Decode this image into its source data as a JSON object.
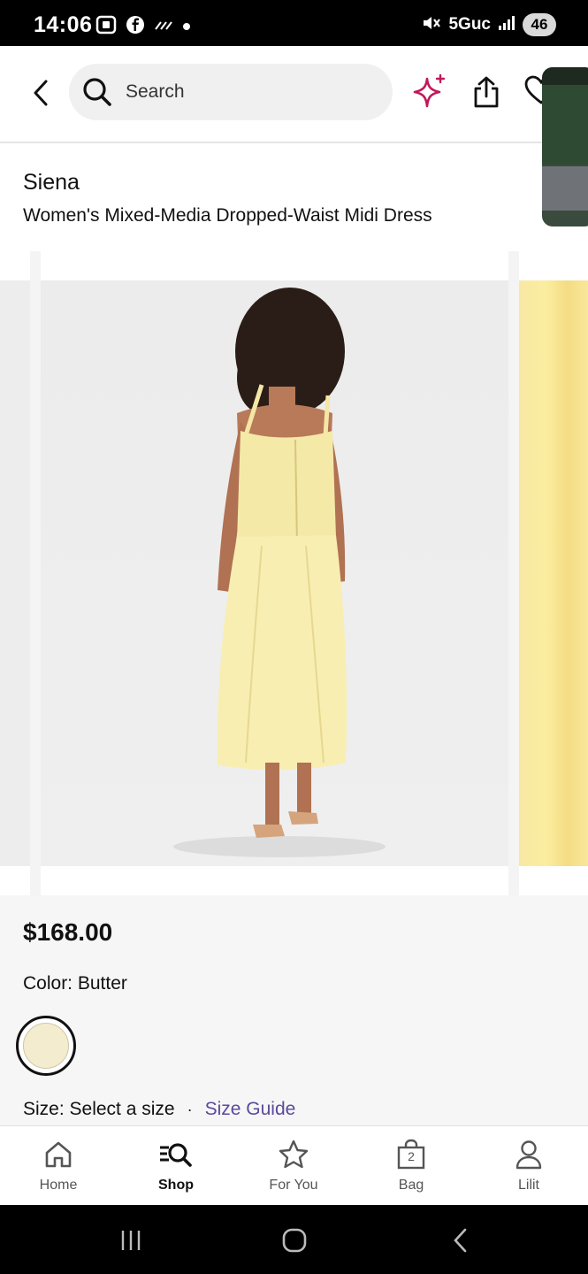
{
  "status_bar": {
    "time": "14:06",
    "network": "5Guc",
    "battery": "46",
    "left_icons": [
      "screenshot-icon",
      "facebook-icon",
      "wifi-calling-icon",
      "dot-icon"
    ],
    "right_icons": [
      "mute-icon",
      "signal-icon"
    ]
  },
  "header": {
    "search_placeholder": "Search",
    "accent_color": "#c2185b"
  },
  "product": {
    "brand": "Siena",
    "name": "Women's Mixed-Media Dropped-Waist Midi Dress",
    "price": "$168.00",
    "color_label": "Color: Butter",
    "swatch_color": "#f4ecce",
    "size_label": "Size: Select a size",
    "size_separator": "·",
    "size_guide": "Size Guide"
  },
  "bottom_nav": {
    "items": [
      {
        "label": "Home",
        "icon": "home-icon"
      },
      {
        "label": "Shop",
        "icon": "shop-search-icon"
      },
      {
        "label": "For You",
        "icon": "star-icon"
      },
      {
        "label": "Bag",
        "icon": "bag-icon",
        "badge": "2"
      },
      {
        "label": "Lilit",
        "icon": "account-icon"
      }
    ],
    "active": "Shop"
  }
}
